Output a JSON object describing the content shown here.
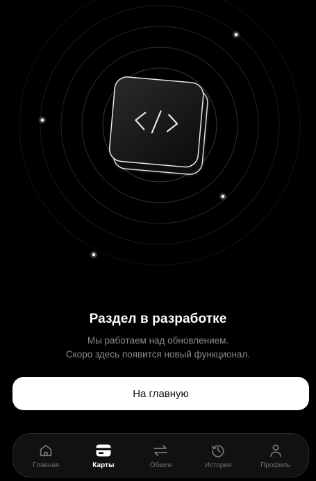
{
  "empty_state": {
    "title": "Раздел в разработке",
    "subtitle_line1": "Мы работаем над обновлением.",
    "subtitle_line2": "Скоро здесь появится новый функционал.",
    "icon": "code-icon"
  },
  "primary_action": {
    "label": "На главную"
  },
  "tabbar": {
    "active": "cards",
    "items": [
      {
        "id": "home",
        "label": "Главная",
        "icon": "home-icon"
      },
      {
        "id": "cards",
        "label": "Карты",
        "icon": "card-icon"
      },
      {
        "id": "exchange",
        "label": "Обмен",
        "icon": "exchange-icon"
      },
      {
        "id": "history",
        "label": "История",
        "icon": "history-icon"
      },
      {
        "id": "profile",
        "label": "Профиль",
        "icon": "profile-icon"
      }
    ]
  },
  "colors": {
    "background": "#000000",
    "button_bg": "#ffffff",
    "muted_text": "#8a8a8a",
    "inactive_tab": "#6f6f6f"
  }
}
